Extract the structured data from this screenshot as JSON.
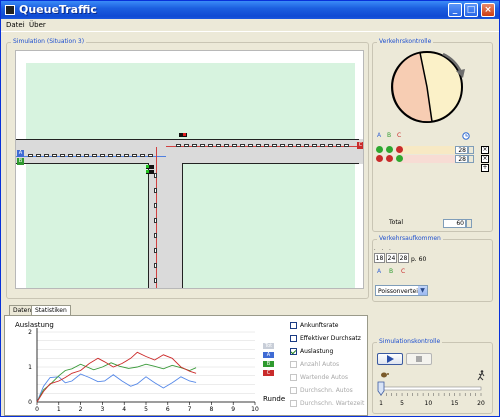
{
  "app": {
    "title": "QueueTraffic"
  },
  "menu": {
    "items": [
      "Datei",
      "Über"
    ]
  },
  "simulation": {
    "group_title": "Simulation (Situation 3)",
    "lanes": [
      {
        "label": "A",
        "color": "#3f6bd4"
      },
      {
        "label": "B",
        "color": "#2f9a2f"
      },
      {
        "label": "C",
        "color": "#c92b2b"
      }
    ]
  },
  "control": {
    "group_title": "Verkehrskontrolle",
    "lane_headers": [
      {
        "label": "A",
        "color": "#3f6bd4"
      },
      {
        "label": "B",
        "color": "#2f9a2f"
      },
      {
        "label": "C",
        "color": "#c92b2b"
      }
    ],
    "phases": [
      {
        "lights": [
          "#2fa82f",
          "#2fa82f",
          "#c92b2b"
        ],
        "duration": "28"
      },
      {
        "lights": [
          "#c92b2b",
          "#c92b2b",
          "#2fa82f"
        ],
        "duration": "28"
      }
    ],
    "phase_buttons": [
      "×",
      "×",
      "+"
    ],
    "total_label": "Total",
    "total_value": "60"
  },
  "traffic": {
    "group_title": "Verkehrsaufkommen",
    "counts": [
      "18",
      "24",
      "28"
    ],
    "lane_labels": [
      {
        "label": "A",
        "color": "#3f6bd4"
      },
      {
        "label": "B",
        "color": "#2f9a2f"
      },
      {
        "label": "C",
        "color": "#c92b2b"
      }
    ],
    "period": "p. 60",
    "distribution": "Poissonverteilt"
  },
  "tabs": {
    "items": [
      "Daten",
      "Statistiken"
    ],
    "active": 1
  },
  "stats": {
    "legend": [
      {
        "label": "Tot",
        "color": "#c8ced8"
      },
      {
        "label": "A",
        "color": "#3f6bd4"
      },
      {
        "label": "B",
        "color": "#2f9a2f"
      },
      {
        "label": "C",
        "color": "#c92b2b"
      }
    ],
    "checkboxes": [
      {
        "label": "Ankunftsrate",
        "checked": false,
        "enabled": true
      },
      {
        "label": "Effektiver Durchsatz",
        "checked": false,
        "enabled": true
      },
      {
        "label": "Auslastung",
        "checked": true,
        "enabled": true
      },
      {
        "label": "Anzahl Autos",
        "checked": false,
        "enabled": false
      },
      {
        "label": "Wartende Autos",
        "checked": false,
        "enabled": false
      },
      {
        "label": "Durchschn. Autos",
        "checked": false,
        "enabled": false
      },
      {
        "label": "Durchschn. Wartezeit",
        "checked": false,
        "enabled": false
      }
    ]
  },
  "chart_data": {
    "type": "line",
    "title": "Auslastung",
    "xlabel": "Runde",
    "ylabel": "Auslastung",
    "xlim": [
      0,
      10
    ],
    "ylim": [
      0,
      2
    ],
    "x_ticks": [
      "0",
      "1",
      "2",
      "3",
      "4",
      "5",
      "6",
      "7",
      "8",
      "9",
      "10"
    ],
    "y_ticks": [
      "0",
      "1",
      "2"
    ],
    "grid": true,
    "series": [
      {
        "name": "A",
        "color": "#5588e8",
        "points": [
          [
            0,
            0
          ],
          [
            0.3,
            0.45
          ],
          [
            0.6,
            0.7
          ],
          [
            1,
            0.72
          ],
          [
            1.3,
            0.55
          ],
          [
            1.6,
            0.6
          ],
          [
            2,
            0.8
          ],
          [
            2.4,
            0.7
          ],
          [
            2.8,
            0.58
          ],
          [
            3.1,
            0.6
          ],
          [
            3.5,
            0.78
          ],
          [
            3.9,
            0.6
          ],
          [
            4.3,
            0.45
          ],
          [
            4.6,
            0.52
          ],
          [
            5,
            0.72
          ],
          [
            5.4,
            0.55
          ],
          [
            5.8,
            0.4
          ],
          [
            6.2,
            0.55
          ],
          [
            6.6,
            0.72
          ],
          [
            7,
            0.6
          ],
          [
            7.3,
            0.56
          ]
        ]
      },
      {
        "name": "B",
        "color": "#3a9a3a",
        "points": [
          [
            0,
            0
          ],
          [
            0.3,
            0.35
          ],
          [
            0.6,
            0.5
          ],
          [
            1,
            0.75
          ],
          [
            1.3,
            0.9
          ],
          [
            1.6,
            0.95
          ],
          [
            2,
            1.08
          ],
          [
            2.3,
            1.0
          ],
          [
            2.6,
            0.92
          ],
          [
            3,
            1.0
          ],
          [
            3.4,
            1.12
          ],
          [
            3.8,
            1.02
          ],
          [
            4.2,
            0.96
          ],
          [
            4.6,
            1.0
          ],
          [
            5,
            1.08
          ],
          [
            5.4,
            1.02
          ],
          [
            5.8,
            0.95
          ],
          [
            6.2,
            1.05
          ],
          [
            6.6,
            0.98
          ],
          [
            7,
            0.9
          ],
          [
            7.3,
            0.98
          ]
        ]
      },
      {
        "name": "C",
        "color": "#cc2a2a",
        "points": [
          [
            0,
            0
          ],
          [
            0.3,
            0.3
          ],
          [
            0.6,
            0.52
          ],
          [
            1,
            0.6
          ],
          [
            1.3,
            0.7
          ],
          [
            1.6,
            0.82
          ],
          [
            2,
            0.9
          ],
          [
            2.4,
            1.1
          ],
          [
            2.8,
            1.25
          ],
          [
            3.1,
            1.15
          ],
          [
            3.5,
            1.0
          ],
          [
            3.9,
            1.1
          ],
          [
            4.3,
            1.25
          ],
          [
            4.6,
            1.42
          ],
          [
            5,
            1.3
          ],
          [
            5.4,
            1.2
          ],
          [
            5.8,
            1.35
          ],
          [
            6.2,
            1.25
          ],
          [
            6.6,
            1.0
          ],
          [
            7,
            0.88
          ],
          [
            7.3,
            0.82
          ]
        ]
      }
    ]
  },
  "sim_control": {
    "group_title": "Simulationskontrolle",
    "slider_ticks": [
      "1",
      "5",
      "10",
      "15",
      "20"
    ],
    "speed": 1
  }
}
